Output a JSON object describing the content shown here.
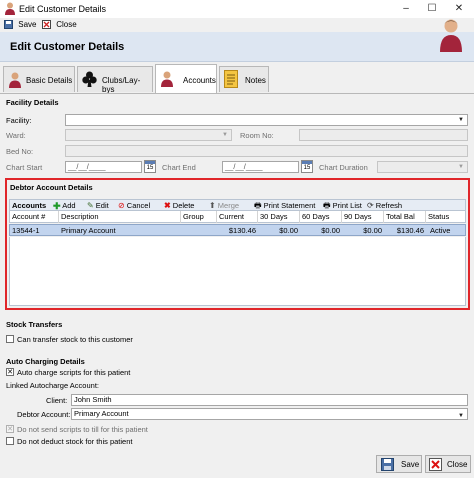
{
  "window": {
    "title": "Edit Customer Details",
    "controls": {
      "minimize": "–",
      "maximize": "☐",
      "close": "✕"
    }
  },
  "toolbar": {
    "save_label": "Save",
    "close_label": "Close"
  },
  "header": {
    "title": "Edit Customer Details"
  },
  "tabs": [
    {
      "label": "Basic Details",
      "icon": "person-icon"
    },
    {
      "label": "Clubs/Lay-bys",
      "icon": "clubs-icon"
    },
    {
      "label": "Accounts",
      "icon": "person-icon",
      "active": true
    },
    {
      "label": "Notes",
      "icon": "notes-icon"
    }
  ],
  "facility": {
    "section_title": "Facility Details",
    "facility_label": "Facility:",
    "facility_value": "",
    "ward_label": "Ward:",
    "room_label": "Room No:",
    "bed_label": "Bed No:",
    "chart_start_label": "Chart Start",
    "chart_start_value": "__/__/____",
    "chart_end_label": "Chart End",
    "chart_end_value": "__/__/____",
    "chart_duration_label": "Chart Duration",
    "calendar_text": "15"
  },
  "debtor": {
    "section_title": "Debtor Account Details",
    "toolbar": {
      "title": "Accounts",
      "add": "Add",
      "edit": "Edit",
      "cancel": "Cancel",
      "delete": "Delete",
      "merge": "Merge",
      "print_statement": "Print Statement",
      "print_list": "Print List",
      "refresh": "Refresh"
    },
    "columns": [
      "Account #",
      "Description",
      "Group",
      "Current",
      "30 Days",
      "60 Days",
      "90 Days",
      "Total Bal",
      "Status"
    ],
    "rows": [
      {
        "account": "13544-1",
        "description": "Primary Account",
        "group": "",
        "current": "$130.46",
        "d30": "$0.00",
        "d60": "$0.00",
        "d90": "$0.00",
        "total": "$130.46",
        "status": "Active"
      }
    ]
  },
  "stock": {
    "section_title": "Stock Transfers",
    "can_transfer_label": "Can transfer stock to this customer",
    "can_transfer_checked": false
  },
  "autocharge": {
    "section_title": "Auto Charging Details",
    "auto_charge_label": "Auto charge scripts for this patient",
    "auto_charge_checked": true,
    "linked_label": "Linked Autocharge Account:",
    "client_label": "Client:",
    "client_value": "John Smith",
    "debtor_label": "Debtor Account:",
    "debtor_value": "Primary Account",
    "no_send_label": "Do not send scripts to till for this patient",
    "no_send_checked": true,
    "no_deduct_label": "Do not deduct stock for this patient",
    "no_deduct_checked": false
  },
  "footer": {
    "save_label": "Save",
    "close_label": "Close"
  },
  "colors": {
    "highlight_border": "#e0262a",
    "selected_row": "#c2d4ee",
    "header_band": "#dde6f2"
  }
}
